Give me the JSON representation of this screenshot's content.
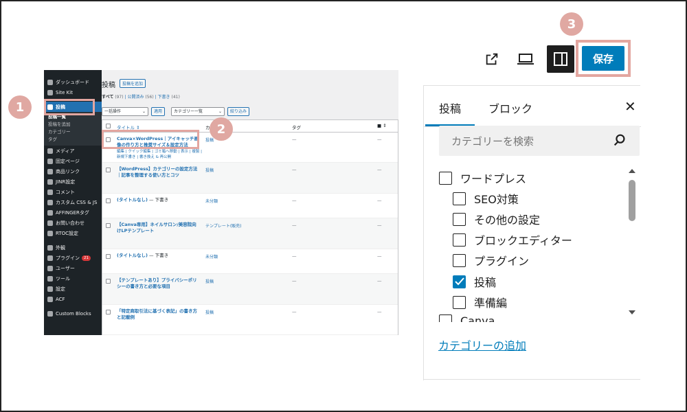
{
  "wp": {
    "sidebar": [
      {
        "label": "ダッシュボード"
      },
      {
        "label": "Site Kit"
      },
      {
        "label": "投稿",
        "active": true
      },
      {
        "label": "メディア"
      },
      {
        "label": "固定ページ"
      },
      {
        "label": "商品リンク"
      },
      {
        "label": "JINR設定"
      },
      {
        "label": "コメント"
      },
      {
        "label": "カスタム CSS & JS"
      },
      {
        "label": "AFFINGERタグ"
      },
      {
        "label": "お問い合わせ"
      },
      {
        "label": "RTOC設定"
      },
      {
        "label": "外観"
      },
      {
        "label": "プラグイン",
        "badge": "21"
      },
      {
        "label": "ユーザー"
      },
      {
        "label": "ツール"
      },
      {
        "label": "設定"
      },
      {
        "label": "ACF"
      },
      {
        "label": "Custom Blocks"
      }
    ],
    "submenu": [
      "投稿一覧",
      "投稿を追加",
      "カテゴリー",
      "タグ"
    ],
    "page_title": "投稿",
    "add_button": "投稿を追加",
    "filters": {
      "all": "すべて",
      "all_count": "(97)",
      "published": "公開済み",
      "published_count": "(56)",
      "draft": "下書き",
      "draft_count": "(41)"
    },
    "bulk_select": "一括操作",
    "apply_button": "適用",
    "category_select": "カテゴリー一覧",
    "filter_button": "絞り込み",
    "columns": {
      "title": "タイトル",
      "category": "カ",
      "tag": "タグ"
    },
    "rows": [
      {
        "title": "Canva×WordPress｜アイキャッチ画像の作り方と推奨サイズ＆設定方法",
        "category": "投稿",
        "tag": "—",
        "comments": "—",
        "actions": "編集 | クイック編集 | ゴミ箱へ移動 | 表示 | 複製 | 新規下書き | 書き換え & 再公開"
      },
      {
        "title": "【WordPress】カテゴリーの設定方法｜記事を整理する使い方とコツ",
        "category": "投稿",
        "tag": "—",
        "comments": "—"
      },
      {
        "title": "(タイトルなし)",
        "status": " — 下書き",
        "category": "未分類",
        "tag": "—",
        "comments": "—"
      },
      {
        "title": "【Canva専用】ネイルサロン/美容院向けLPテンプレート",
        "category": "テンプレート(販売)",
        "tag": "—",
        "comments": "—"
      },
      {
        "title": "(タイトルなし)",
        "status": " — 下書き",
        "category": "未分類",
        "tag": "—",
        "comments": "—"
      },
      {
        "title": "【テンプレートあり】プライバシーポリシーの書き方と必要な項目",
        "category": "投稿",
        "tag": "—",
        "comments": "—"
      },
      {
        "title": "「特定商取引法に基づく表記」の書き方と記載例",
        "category": "投稿",
        "tag": "—",
        "comments": "—"
      }
    ]
  },
  "steps": [
    "1",
    "2",
    "3"
  ],
  "toolbar": {
    "view_icon": "external-link-icon",
    "preview_icon": "laptop-icon",
    "settings_icon": "sidebar-toggle-icon",
    "save_label": "保存"
  },
  "panel": {
    "tab_post": "投稿",
    "tab_block": "ブロック",
    "close": "✕",
    "search_placeholder": "カテゴリーを検索",
    "categories": [
      {
        "label": "ワードプレス",
        "checked": false,
        "level": 0
      },
      {
        "label": "SEO対策",
        "checked": false,
        "level": 1
      },
      {
        "label": "その他の設定",
        "checked": false,
        "level": 1
      },
      {
        "label": "ブロックエディター",
        "checked": false,
        "level": 1
      },
      {
        "label": "プラグイン",
        "checked": false,
        "level": 1
      },
      {
        "label": "投稿",
        "checked": true,
        "level": 1
      },
      {
        "label": "準備編",
        "checked": false,
        "level": 1
      },
      {
        "label": "Canva",
        "checked": false,
        "level": 0
      }
    ],
    "add_category": "カテゴリーの追加"
  },
  "colors": {
    "accent": "#007cba",
    "highlight": "#e3a6a0",
    "badge": "#e0a8a2",
    "wp_sidebar": "#1d2327"
  }
}
